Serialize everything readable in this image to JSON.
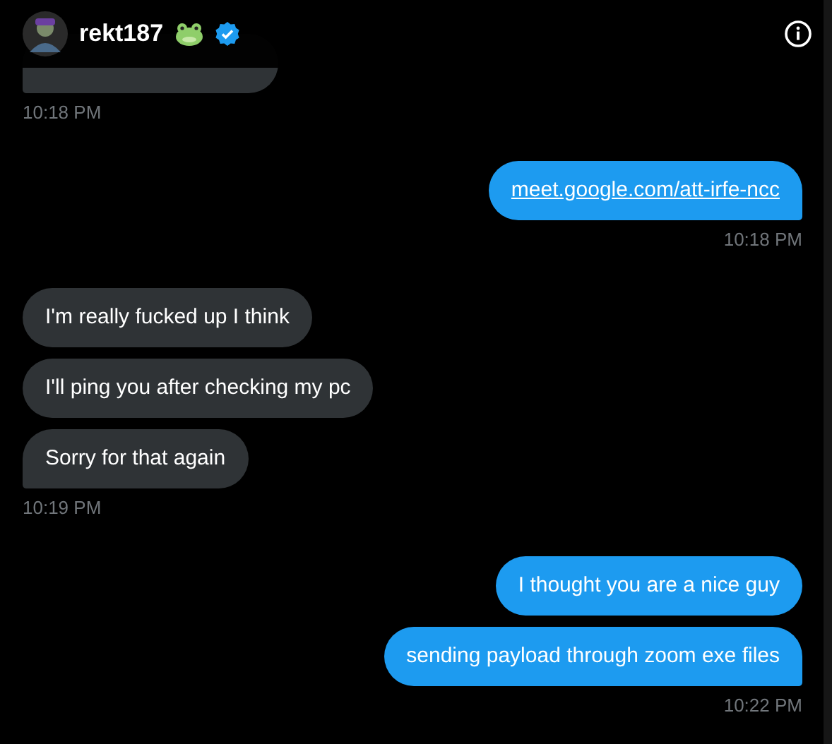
{
  "header": {
    "username": "rekt187"
  },
  "groups": [
    {
      "kind": "incoming",
      "messages": [
        {
          "kind": "hidden"
        }
      ],
      "time": "10:18 PM"
    },
    {
      "kind": "outgoing",
      "messages": [
        {
          "kind": "link",
          "text": "meet.google.com/att-irfe-ncc"
        }
      ],
      "time": "10:18 PM"
    },
    {
      "kind": "incoming",
      "messages": [
        {
          "kind": "text",
          "text": "I'm really fucked up I think"
        },
        {
          "kind": "text",
          "text": "I'll ping you after checking my pc"
        },
        {
          "kind": "text",
          "text": "Sorry for that again"
        }
      ],
      "time": "10:19 PM"
    },
    {
      "kind": "outgoing",
      "messages": [
        {
          "kind": "text",
          "text": "I thought you are a nice guy"
        },
        {
          "kind": "text",
          "text": "sending payload through zoom exe files"
        }
      ],
      "time": "10:22 PM"
    }
  ]
}
